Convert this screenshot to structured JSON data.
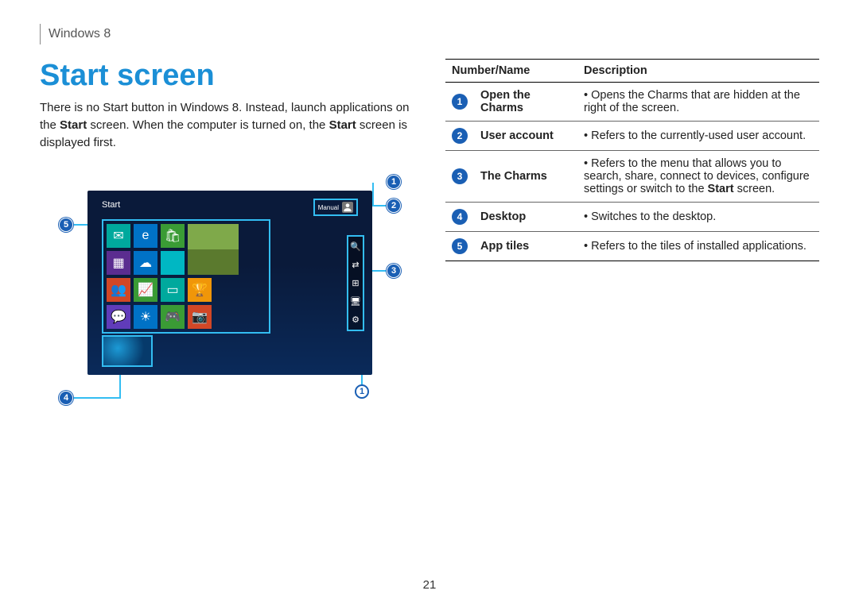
{
  "header": {
    "section": "Windows 8"
  },
  "title": "Start screen",
  "body": {
    "p1a": "There is no Start button in Windows 8. Instead, launch applications on the ",
    "p1b": "Start",
    "p1c": " screen. When the computer is turned on, the ",
    "p1d": "Start",
    "p1e": " screen is displayed first."
  },
  "figure": {
    "start_label": "Start",
    "user_label": "Manual",
    "callouts": {
      "c1": "1",
      "c2": "2",
      "c3": "3",
      "c4": "4",
      "c5": "5"
    }
  },
  "table": {
    "headers": {
      "numname": "Number/Name",
      "desc": "Description"
    },
    "rows": [
      {
        "num": "1",
        "name": "Open the Charms",
        "desc": "Opens the Charms that are hidden at the right of the screen."
      },
      {
        "num": "2",
        "name": "User account",
        "desc": "Refers to the currently-used user account."
      },
      {
        "num": "3",
        "name": "The Charms",
        "desc_pre": "Refers to the menu that allows you to search, share, connect to devices, configure settings or switch to the ",
        "desc_bold": "Start",
        "desc_post": " screen."
      },
      {
        "num": "4",
        "name": "Desktop",
        "desc": "Switches to the desktop."
      },
      {
        "num": "5",
        "name": "App tiles",
        "desc": "Refers to the tiles of installed applications."
      }
    ]
  },
  "page_number": "21"
}
